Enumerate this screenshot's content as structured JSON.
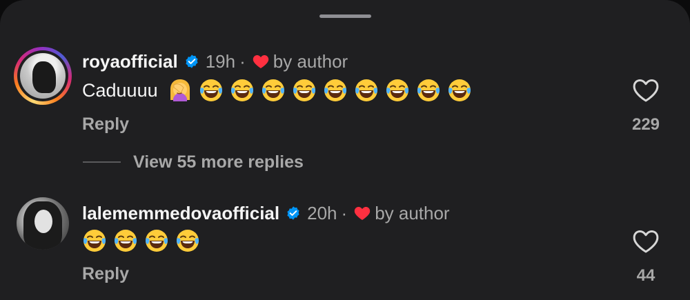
{
  "comments": [
    {
      "username": "royaofficial",
      "time": "19h",
      "separator": "·",
      "liked_by": "by author",
      "text": "Caduuuu",
      "emojis": [
        "woman-facepalming",
        "face-with-tears-of-joy",
        "face-with-tears-of-joy",
        "face-with-tears-of-joy",
        "face-with-tears-of-joy",
        "face-with-tears-of-joy",
        "face-with-tears-of-joy",
        "face-with-tears-of-joy",
        "face-with-tears-of-joy",
        "face-with-tears-of-joy"
      ],
      "reply_label": "Reply",
      "like_count": "229",
      "has_story_ring": true
    },
    {
      "username": "lalememmedovaofficial",
      "time": "20h",
      "separator": "·",
      "liked_by": "by author",
      "text": "",
      "emojis": [
        "face-with-tears-of-joy",
        "face-with-tears-of-joy",
        "face-with-tears-of-joy",
        "face-with-tears-of-joy"
      ],
      "reply_label": "Reply",
      "like_count": "44",
      "has_story_ring": false
    }
  ],
  "view_more_replies": "View 55 more replies",
  "colors": {
    "background": "#1f1f21",
    "primary_text": "#f5f5f5",
    "secondary_text": "#a8a8a8",
    "verified_badge": "#0095f6",
    "author_heart": "#ff3040"
  },
  "icons": {
    "verified": "verified-badge-icon",
    "author_like": "heart-filled-icon",
    "like": "heart-outline-icon"
  }
}
